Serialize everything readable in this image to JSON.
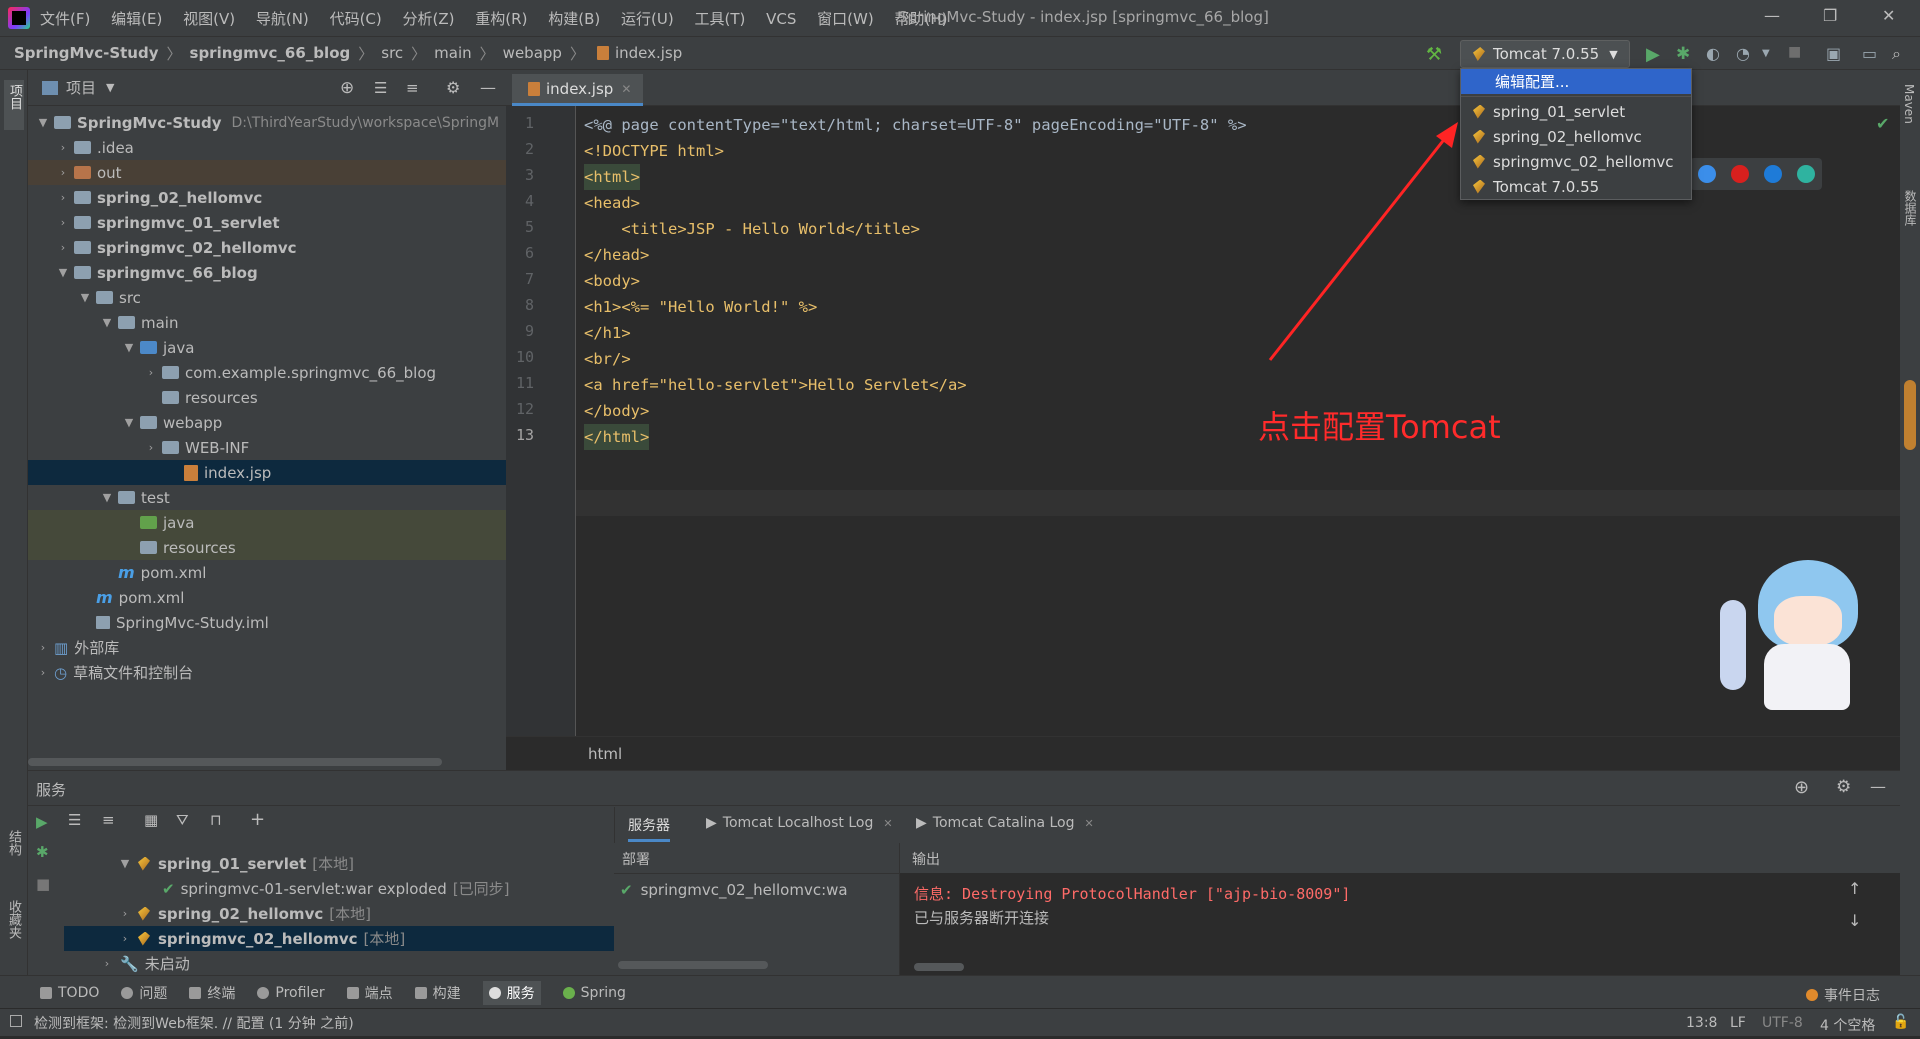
{
  "titlebar": {
    "menus": [
      "文件(F)",
      "编辑(E)",
      "视图(V)",
      "导航(N)",
      "代码(C)",
      "分析(Z)",
      "重构(R)",
      "构建(B)",
      "运行(U)",
      "工具(T)",
      "VCS",
      "窗口(W)",
      "帮助(H)"
    ],
    "window_title": "SpringMvc-Study - index.jsp [springmvc_66_blog]"
  },
  "breadcrumb": [
    "SpringMvc-Study",
    "springmvc_66_blog",
    "src",
    "main",
    "webapp",
    "index.jsp"
  ],
  "run_config": {
    "selected": "Tomcat 7.0.55"
  },
  "dropdown": {
    "edit_label": "编辑配置...",
    "items": [
      "spring_01_servlet",
      "spring_02_hellomvc",
      "springmvc_02_hellomvc",
      "Tomcat 7.0.55"
    ]
  },
  "project": {
    "title": "项目",
    "root_name": "SpringMvc-Study",
    "root_path": "D:\\ThirdYearStudy\\workspace\\SpringM",
    "items": [
      ".idea",
      "out",
      "spring_02_hellomvc",
      "springmvc_01_servlet",
      "springmvc_02_hellomvc",
      "springmvc_66_blog",
      "src",
      "main",
      "java",
      "com.example.springmvc_66_blog",
      "resources",
      "webapp",
      "WEB-INF",
      "index.jsp",
      "test",
      "java",
      "resources",
      "pom.xml",
      "pom.xml",
      "SpringMvc-Study.iml",
      "外部库",
      "草稿文件和控制台"
    ]
  },
  "editor": {
    "tab": "index.jsp",
    "lines": [
      "<%@ page contentType=\"text/html; charset=UTF-8\" pageEncoding=\"UTF-8\" %>",
      "<!DOCTYPE html>",
      "<html>",
      "<head>",
      "    <title>JSP - Hello World</title>",
      "</head>",
      "<body>",
      "<h1><%= \"Hello World!\" %>",
      "</h1>",
      "<br/>",
      "<a href=\"hello-servlet\">Hello Servlet</a>",
      "</body>",
      "</html>"
    ],
    "line_numbers": [
      "1",
      "2",
      "3",
      "4",
      "5",
      "6",
      "7",
      "8",
      "9",
      "10",
      "11",
      "12",
      "13"
    ],
    "status_path": "html"
  },
  "annotation": "点击配置Tomcat",
  "services": {
    "title": "服务",
    "tree": [
      {
        "name": "spring_01_servlet",
        "tag": "[本地]"
      },
      {
        "name": "springmvc-01-servlet:war exploded",
        "tag": "[已同步]"
      },
      {
        "name": "spring_02_hellomvc",
        "tag": "[本地]"
      },
      {
        "name": "springmvc_02_hellomvc",
        "tag": "[本地]"
      },
      {
        "name": "未启动",
        "tag": ""
      }
    ],
    "tabs": [
      "服务器",
      "Tomcat Localhost Log",
      "Tomcat Catalina Log"
    ],
    "deploy_header": "部署",
    "output_header": "输出",
    "deploy_item": "springmvc_02_hellomvc:wa",
    "output_lines": [
      "信息: Destroying ProtocolHandler [\"ajp-bio-8009\"]",
      "已与服务器断开连接"
    ]
  },
  "bottom_tabs": [
    "TODO",
    "问题",
    "终端",
    "Profiler",
    "端点",
    "构建",
    "服务",
    "Spring"
  ],
  "event_log": "事件日志",
  "status": {
    "message": "检测到框架: 检测到Web框架. // 配置 (1 分钟 之前)",
    "position": "13:8",
    "line_sep": "LF",
    "encoding": "UTF-8",
    "indent": "4 个空格"
  },
  "side_labels": {
    "left_top": "项目",
    "left_mid": "结构",
    "left_bottom": "收藏夹",
    "right_top": "Maven",
    "right_mid": "数据库"
  }
}
